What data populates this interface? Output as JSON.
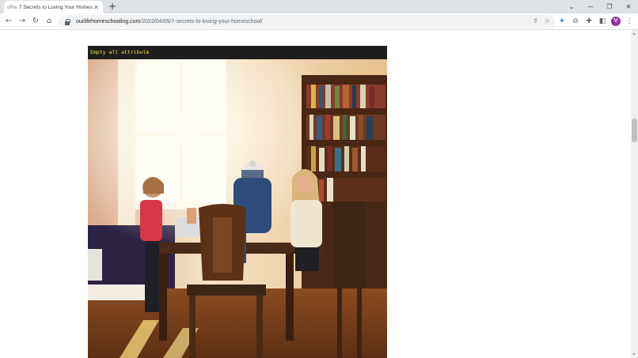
{
  "browser": {
    "tab": {
      "favicon": "olhs",
      "title": "7 Secrets to Loving Your Homesc",
      "close_glyph": "✕"
    },
    "new_tab_glyph": "+",
    "window_controls": {
      "dropdown": "⌄",
      "minimize": "—",
      "restore": "❐",
      "close": "✕"
    },
    "nav": {
      "back": "←",
      "forward": "→",
      "reload": "↻",
      "home": "⌂"
    },
    "address": {
      "host": "ourlifehomeschooling.com",
      "path": "/2023/04/05/7-secrets-to-loving-your-homeschool/"
    },
    "omnibox_icons": {
      "share": "⇪",
      "bookmark": "☆"
    },
    "toolbar_icons": {
      "extension_pin": "✦",
      "lens": "⊖",
      "extensions": "✚",
      "sidepanel": "◧",
      "menu": "⋮"
    },
    "profile_initial": "V"
  },
  "page": {
    "photo_overlay_text": "Empty alt attribute",
    "photo_icon": "photo-of-children-at-table"
  },
  "colors": {
    "overlay_bg": "#1e1e1e",
    "overlay_text": "#f2e24a",
    "avatar": "#9334a5",
    "tab_strip": "#dee1e6"
  }
}
